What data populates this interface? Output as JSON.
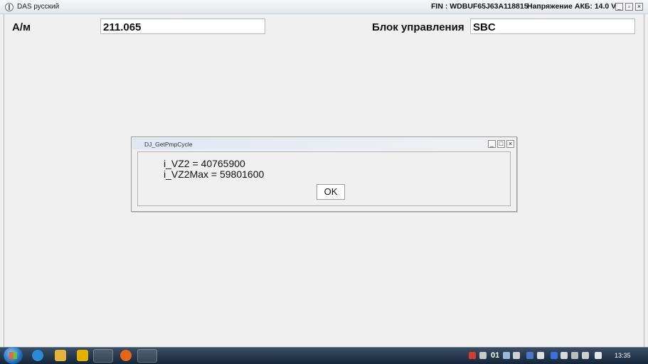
{
  "window": {
    "title": "DAS русский",
    "fin": "FIN : WDBUF65J63A118815",
    "battery": "Напряжение АКБ: 14.0 V",
    "minimize": "_",
    "maximize": "▫",
    "close": "×"
  },
  "form": {
    "model_label": "А/м",
    "model_value": "211.065",
    "ecu_label": "Блок управления",
    "ecu_value": "SBC"
  },
  "dialog": {
    "title": "DJ_GetPmpCycle",
    "line1": "i_VZ2 = 40765900",
    "line2": "i_VZ2Max = 59801600",
    "ok_label": "OK",
    "minimize": "_",
    "maximize": "□",
    "close": "×"
  },
  "taskbar": {
    "tray_text": "01",
    "clock": "13:35"
  },
  "colors": {
    "background": "#f0f0f0",
    "taskbar": "#1c2c40",
    "firefox": "#e8641a",
    "explorer": "#e3b33a",
    "ie": "#2a8ad6",
    "media": "#e3b100"
  }
}
